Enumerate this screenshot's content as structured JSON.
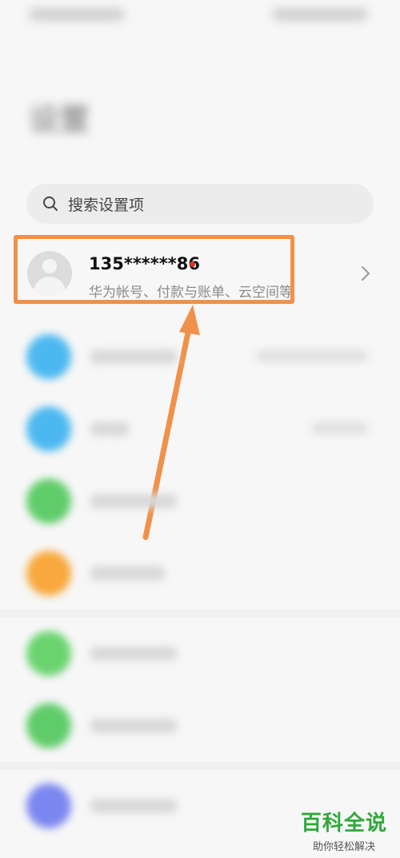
{
  "page": {
    "title": "设置"
  },
  "search": {
    "placeholder": "搜索设置项",
    "icon": "search-icon"
  },
  "account": {
    "name": "135******86",
    "description": "华为帐号、付款与账单、云空间等",
    "avatar_icon": "person-icon",
    "chevron_icon": "chevron-right-icon",
    "notification_dot_color": "#e03020"
  },
  "annotation": {
    "highlight_color": "#f0914a"
  },
  "settings_items": [
    {
      "icon_color": "#4cb8f0",
      "has_value": true
    },
    {
      "icon_color": "#4cb8f0",
      "has_value": true
    },
    {
      "icon_color": "#5fcc6a",
      "has_value": false
    },
    {
      "icon_color": "#f8a83c",
      "has_value": false
    },
    {
      "icon_color": "#6ad36e",
      "has_value": false
    },
    {
      "icon_color": "#5fcc6a",
      "has_value": false
    },
    {
      "icon_color": "#7b87f0",
      "has_value": false
    }
  ],
  "watermark": {
    "title": "百科全说",
    "subtitle": "助你轻松解决"
  }
}
